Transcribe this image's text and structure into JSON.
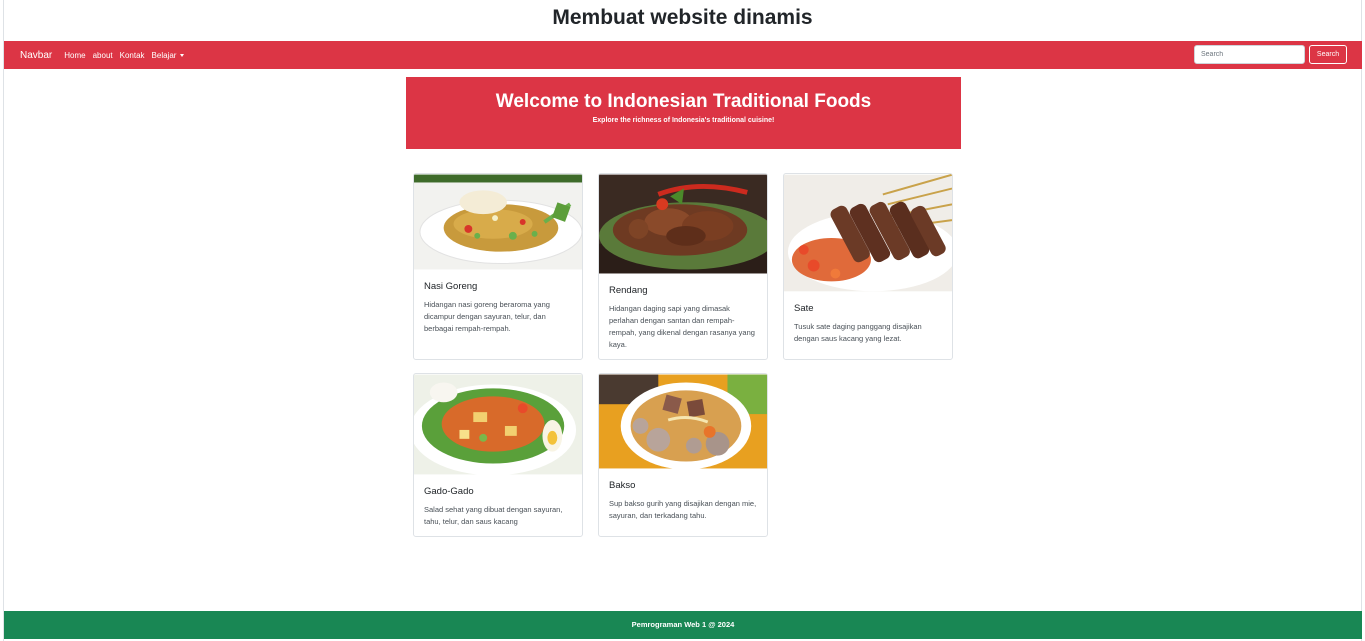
{
  "page": {
    "title": "Membuat website dinamis"
  },
  "navbar": {
    "brand": "Navbar",
    "links": [
      "Home",
      "about",
      "Kontak"
    ],
    "dropdown_label": "Belajar",
    "search_placeholder": "Search",
    "search_button": "Search",
    "color": "#dc3545"
  },
  "hero": {
    "title": "Welcome to Indonesian Traditional Foods",
    "subtitle": "Explore the richness of Indonesia's traditional cuisine!"
  },
  "cards": [
    {
      "title": "Nasi Goreng",
      "text": "Hidangan nasi goreng beraroma yang dicampur dengan sayuran, telur, dan berbagai rempah-rempah.",
      "image": "nasi-goreng-photo"
    },
    {
      "title": "Rendang",
      "text": "Hidangan daging sapi yang dimasak perlahan dengan santan dan rempah-rempah, yang dikenal dengan rasanya yang kaya.",
      "image": "rendang-photo"
    },
    {
      "title": "Sate",
      "text": "Tusuk sate daging panggang disajikan dengan saus kacang yang lezat.",
      "image": "sate-photo"
    },
    {
      "title": "Gado-Gado",
      "text": "Salad sehat yang dibuat dengan sayuran, tahu, telur, dan saus kacang",
      "image": "gado-gado-photo"
    },
    {
      "title": "Bakso",
      "text": "Sup bakso gurih yang disajikan dengan mie, sayuran, dan terkadang tahu.",
      "image": "bakso-photo"
    }
  ],
  "footer": {
    "text": "Pemrograman Web 1 @ 2024",
    "color": "#198754"
  }
}
